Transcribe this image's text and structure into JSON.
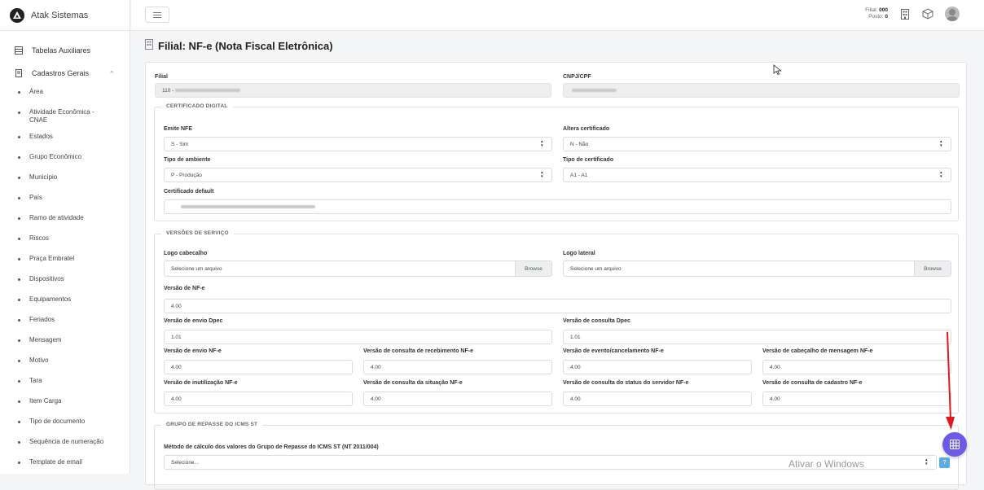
{
  "app": {
    "brand": "Atak Sistemas"
  },
  "sidebar": {
    "sections": [
      {
        "label": "Tabelas Auxiliares",
        "icon": "table-icon"
      },
      {
        "label": "Cadastros Gerais",
        "icon": "document-icon",
        "expanded": true
      }
    ],
    "items": [
      "Área",
      "Atividade Econômica - CNAE",
      "Estados",
      "Grupo Econômico",
      "Município",
      "País",
      "Ramo de atividade",
      "Riscos",
      "Praça Embratel",
      "Dispositivos",
      "Equipamentos",
      "Feriados",
      "Mensagem",
      "Motivo",
      "Tara",
      "Item Carga",
      "Tipo de documento",
      "Sequência de numeração",
      "Template de email"
    ]
  },
  "topbar": {
    "filial_label": "Filial:",
    "filial_value": "000",
    "posto_label": "Posto:",
    "posto_value": "0"
  },
  "page": {
    "title": "Filial: NF-e (Nota Fiscal Eletrônica)"
  },
  "form": {
    "filial_label": "Filial",
    "filial_value": "110 -",
    "cnpj_label": "CNPJ/CPF",
    "cert": {
      "legend": "CERTIFICADO DIGITAL",
      "emite_label": "Emite NFE",
      "emite_value": "S - Sim",
      "altera_label": "Altera certificado",
      "altera_value": "N - Não",
      "ambiente_label": "Tipo de ambiente",
      "ambiente_value": "P - Produção",
      "tipo_cert_label": "Tipo de certificado",
      "tipo_cert_value": "A1 - A1",
      "default_label": "Certificado default"
    },
    "versoes": {
      "legend": "VERSÕES DE SERVIÇO",
      "logo_cab_label": "Logo cabecalho",
      "logo_cab_placeholder": "Selecione um arquivo",
      "logo_lat_label": "Logo lateral",
      "logo_lat_placeholder": "Selecione um arquivo",
      "browse": "Browse",
      "nfe_label": "Versão de NF-e",
      "nfe_value": "4.00",
      "envio_dpec_label": "Versão de envio Dpec",
      "envio_dpec_value": "1.01",
      "consulta_dpec_label": "Versão de consulta Dpec",
      "consulta_dpec_value": "1.01",
      "envio_nfe_label": "Versão de envio NF-e",
      "envio_nfe_value": "4.00",
      "cons_receb_label": "Versão de consulta de recebimento NF-e",
      "cons_receb_value": "4.00",
      "evento_label": "Versão de evento/cancelamento NF-e",
      "evento_value": "4.00",
      "cabecalho_label": "Versão de cabeçalho de mensagem NF-e",
      "cabecalho_value": "4.00",
      "inutil_label": "Versão de inutilização NF-e",
      "inutil_value": "4.00",
      "cons_sit_label": "Versão de consulta da situação NF-e",
      "cons_sit_value": "4.00",
      "cons_status_label": "Versão de consulta do status do servidor NF-e",
      "cons_status_value": "4.00",
      "cons_cad_label": "Versão de consulta de cadastro NF-e",
      "cons_cad_value": "4.00"
    },
    "icms": {
      "legend": "GRUPO DE REPASSE DO ICMS ST",
      "metodo_label": "Método de cálculo dos valores do Grupo de Repasse do ICMS ST (NT 2011/004)",
      "metodo_value": "Selecione...",
      "help": "?"
    }
  },
  "overlay": {
    "watermark": "Ativar o Windows"
  },
  "colors": {
    "accent": "#6b5be6",
    "help": "#5dade2",
    "arrow": "#e0191f"
  }
}
